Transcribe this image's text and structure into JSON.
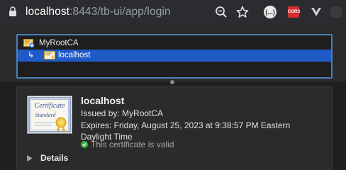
{
  "browser": {
    "url_host": "localhost",
    "url_rest": ":8443/tb-ui/app/login",
    "extension_dots_label": "(...)",
    "extension_cors_label": "CORS"
  },
  "dialog": {
    "tree": {
      "root_label": "MyRootCA",
      "child_label": "localhost"
    },
    "certificate": {
      "title": "localhost",
      "issued_by": "Issued by: MyRootCA",
      "expires_line1": "Expires: Friday, August 25, 2023 at 9:38:57 PM Eastern",
      "expires_line2": "Daylight Time",
      "valid_text": "This certificate is valid"
    },
    "details_label": "Details"
  },
  "colors": {
    "selection": "#1f5ac7",
    "valid_green": "#3cb043",
    "tree_border": "#4a7fb5"
  }
}
